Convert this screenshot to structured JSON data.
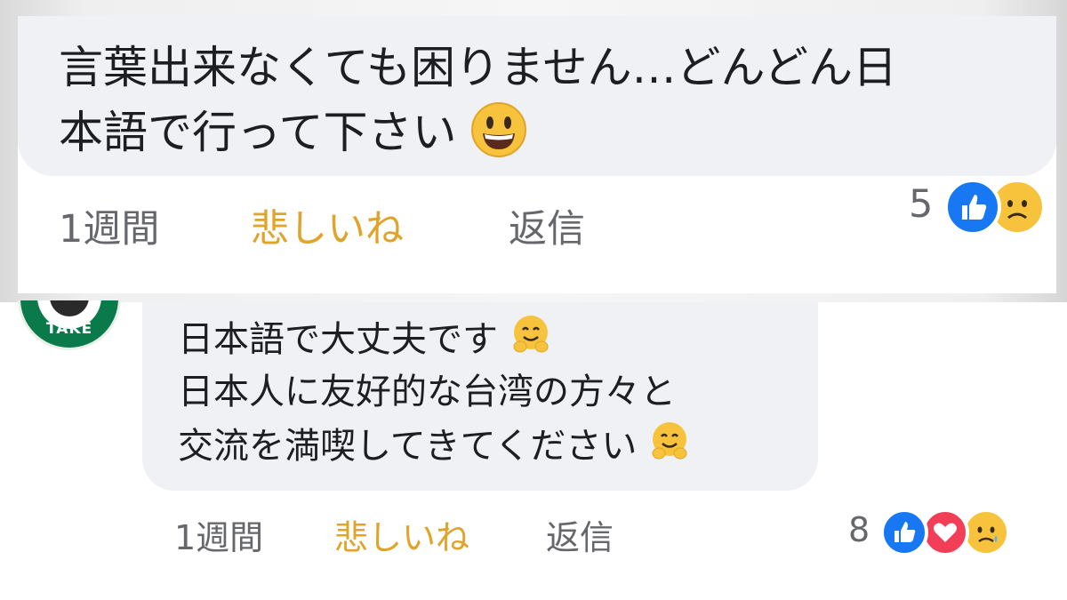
{
  "comment1": {
    "text_line1": "言葉出来なくても困りません…どんどん日",
    "text_line2": "本語で行って下さい",
    "emoji": "grinning-face",
    "time": "1週間",
    "reaction_label": "悲しいね",
    "reply_label": "返信",
    "reaction_count": "5",
    "reactions": [
      "like",
      "sad"
    ]
  },
  "comment2": {
    "avatar_text": "TAKE",
    "text_line1": "日本語で大丈夫です",
    "text_line2": "日本人に友好的な台湾の方々と",
    "text_line3": "交流を満喫してきてください",
    "emoji": "hugging-face",
    "time": "1週間",
    "reaction_label": "悲しいね",
    "reply_label": "返信",
    "reaction_count": "8",
    "reactions": [
      "like",
      "love",
      "sad"
    ]
  },
  "colors": {
    "bubble": "#f0f1f4",
    "meta_text": "#65676b",
    "reacted": "#e0a42a",
    "like": "#1877f2",
    "love": "#f33e58",
    "sad": "#f7c23c"
  }
}
